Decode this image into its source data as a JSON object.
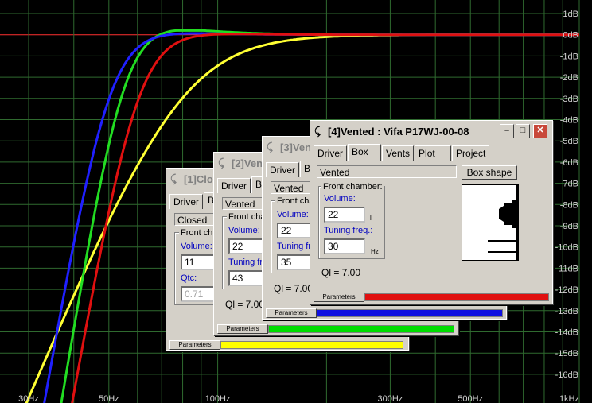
{
  "graph": {
    "db_labels": [
      "1dB",
      "0dB",
      "-1dB",
      "-2dB",
      "-3dB",
      "-4dB",
      "-5dB",
      "-6dB",
      "-7dB",
      "-8dB",
      "-9dB",
      "-10dB",
      "-11dB",
      "-12dB",
      "-13dB",
      "-14dB",
      "-15dB",
      "-16dB"
    ],
    "hz_labels": [
      "30Hz",
      "50Hz",
      "100Hz",
      "300Hz",
      "500Hz",
      "1kHz"
    ],
    "colors": {
      "background": "#000000",
      "grid": "#2f6a2f",
      "zero_line": "#ff3030",
      "labels": "#d0d0d0"
    },
    "curves": [
      {
        "color": "#ffff33",
        "window": "1"
      },
      {
        "color": "#22dd22",
        "window": "2"
      },
      {
        "color": "#2020ff",
        "window": "3"
      },
      {
        "color": "#e01010",
        "window": "4"
      }
    ]
  },
  "windows": [
    {
      "title": "[1]Closed : Vifa P17WJ-00-08",
      "tabs": [
        "Driver",
        "Box"
      ],
      "box_type": "Closed",
      "group_label": "Front chamber:",
      "field1_label": "Volume:",
      "field1_value": "11",
      "field2_label": "Qtc:",
      "field2_value": "0.71",
      "ql": "",
      "params_label": "Parameters",
      "bar_color": "#ffff00"
    },
    {
      "title": "[2]Vented : Vifa P17WJ-00-08",
      "tabs": [
        "Driver",
        "Box"
      ],
      "box_type": "Vented",
      "group_label": "Front chamber:",
      "field1_label": "Volume:",
      "field1_value": "22",
      "field2_label": "Tuning freq.:",
      "field2_value": "43",
      "ql": "Ql = 7.00",
      "params_label": "Parameters",
      "bar_color": "#00dd00"
    },
    {
      "title": "[3]Vented : Vifa P17WJ-00-08",
      "tabs": [
        "Driver",
        "Box"
      ],
      "box_type": "Vented",
      "group_label": "Front chamber:",
      "field1_label": "Volume:",
      "field1_value": "22",
      "field2_label": "Tuning freq.:",
      "field2_value": "35",
      "ql": "Ql = 7.00",
      "params_label": "Parameters",
      "bar_color": "#1010e0"
    },
    {
      "title": "[4]Vented : Vifa P17WJ-00-08",
      "tabs": [
        "Driver",
        "Box",
        "Vents",
        "Plot",
        "Project"
      ],
      "box_type": "Vented",
      "box_shape_label": "Box shape",
      "group_label": "Front chamber:",
      "field1_label": "Volume:",
      "field1_value": "22",
      "field1_unit": "l",
      "field2_label": "Tuning freq.:",
      "field2_value": "30",
      "field2_unit": "Hz",
      "ql": "Ql = 7.00",
      "params_label": "Parameters",
      "bar_color": "#e01010"
    }
  ]
}
